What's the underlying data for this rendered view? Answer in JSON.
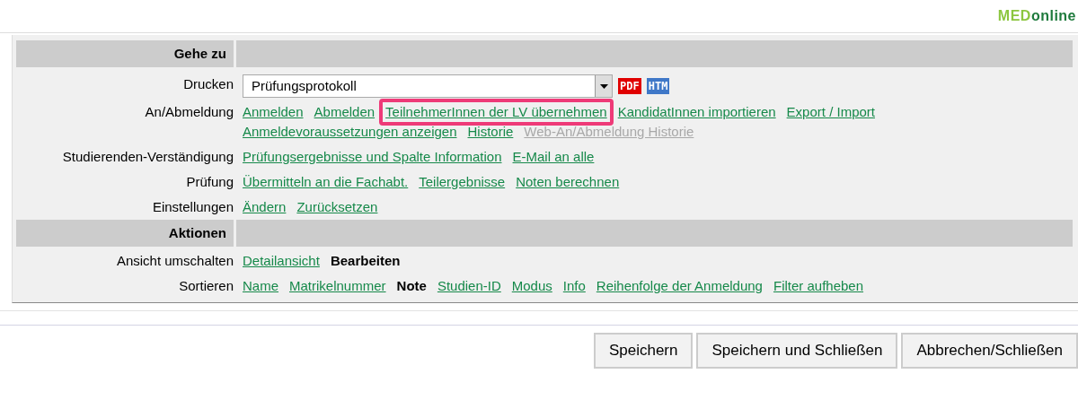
{
  "logo": {
    "part_1": "MED",
    "part_2": "online"
  },
  "sections": [
    {
      "title": "Gehe zu",
      "rows": [
        {
          "label": "Drucken",
          "kind": "select",
          "value": "Prüfungsprotokoll",
          "icons": [
            {
              "text": "PDF",
              "color": "#e00000"
            },
            {
              "text": "HTM",
              "color": "#3f78c8"
            }
          ]
        },
        {
          "label": "An/Abmeldung",
          "kind": "links",
          "items": [
            {
              "text": "Anmelden",
              "kind": "link",
              "highlighted": false
            },
            {
              "text": "Abmelden",
              "kind": "link",
              "highlighted": false
            },
            {
              "text": "TeilnehmerInnen der LV übernehmen",
              "kind": "link",
              "highlighted": true
            },
            {
              "text": "KandidatInnen importieren",
              "kind": "link",
              "highlighted": false
            },
            {
              "text": "Export / Import",
              "kind": "link",
              "highlighted": false
            },
            {
              "text": "Anmeldevoraussetzungen anzeigen",
              "kind": "link",
              "highlighted": false
            },
            {
              "text": "Historie",
              "kind": "link",
              "highlighted": false
            },
            {
              "text": "Web-An/Abmeldung Historie",
              "kind": "disabled",
              "highlighted": false
            }
          ]
        },
        {
          "label": "Studierenden-Verständigung",
          "kind": "links",
          "items": [
            {
              "text": "Prüfungsergebnisse und Spalte Information",
              "kind": "link"
            },
            {
              "text": "E-Mail an alle",
              "kind": "link"
            }
          ]
        },
        {
          "label": "Prüfung",
          "kind": "links",
          "items": [
            {
              "text": "Übermitteln an die Fachabt.",
              "kind": "link"
            },
            {
              "text": "Teilergebnisse",
              "kind": "link"
            },
            {
              "text": "Noten berechnen",
              "kind": "link"
            }
          ]
        },
        {
          "label": "Einstellungen",
          "kind": "links",
          "items": [
            {
              "text": "Ändern",
              "kind": "link"
            },
            {
              "text": "Zurücksetzen",
              "kind": "link"
            }
          ]
        }
      ]
    },
    {
      "title": "Aktionen",
      "rows": [
        {
          "label": "Ansicht umschalten",
          "kind": "links",
          "items": [
            {
              "text": "Detailansicht",
              "kind": "link"
            },
            {
              "text": "Bearbeiten",
              "kind": "current"
            }
          ]
        },
        {
          "label": "Sortieren",
          "kind": "links",
          "items": [
            {
              "text": "Name",
              "kind": "link"
            },
            {
              "text": "Matrikelnummer",
              "kind": "link"
            },
            {
              "text": "Note",
              "kind": "current"
            },
            {
              "text": "Studien-ID",
              "kind": "link"
            },
            {
              "text": "Modus",
              "kind": "link"
            },
            {
              "text": "Info",
              "kind": "link"
            },
            {
              "text": "Reihenfolge der Anmeldung",
              "kind": "link"
            },
            {
              "text": "Filter aufheben",
              "kind": "link"
            }
          ]
        }
      ]
    }
  ],
  "buttons": [
    "Speichern",
    "Speichern und Schließen",
    "Abbrechen/Schließen"
  ]
}
